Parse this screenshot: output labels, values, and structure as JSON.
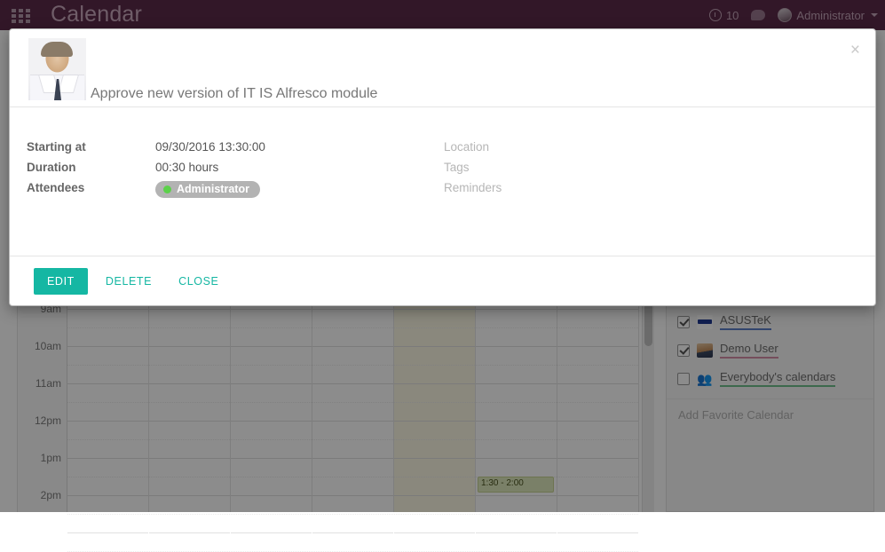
{
  "navbar": {
    "apps_icon": "apps-grid-icon",
    "brand": "Calendar",
    "activity_icon": "clock-icon",
    "activity_count": "10",
    "messages_icon": "chat-bubble-icon",
    "user_name": "Administrator",
    "user_caret": "chevron-down-icon"
  },
  "modal": {
    "title": "Approve new version of IT IS Alfresco module",
    "avatar_icon": "user-photo-avatar",
    "close_icon": "close-icon",
    "close_label": "×",
    "fields_left": [
      {
        "label": "Starting at",
        "value": "09/30/2016 13:30:00"
      },
      {
        "label": "Duration",
        "value": "00:30 hours"
      },
      {
        "label": "Attendees",
        "value": ""
      }
    ],
    "attendee": {
      "name": "Administrator",
      "status_icon": "status-dot-online",
      "status_color": "#5cd14a"
    },
    "fields_right": [
      {
        "label": "Location",
        "value": ""
      },
      {
        "label": "Tags",
        "value": ""
      },
      {
        "label": "Reminders",
        "value": ""
      }
    ],
    "footer": {
      "edit_label": "EDIT",
      "delete_label": "DELETE",
      "close_label": "CLOSE"
    }
  },
  "calendar": {
    "time_labels": [
      "9am",
      "10am",
      "11am",
      "12pm",
      "1pm",
      "2pm"
    ],
    "day_count": 7,
    "today_column_index": 4,
    "events": [
      {
        "label": "1:30 - 2:00",
        "column": 5,
        "start_hour_offset": 4.5,
        "duration_hours": 0.5
      }
    ]
  },
  "sidebar": {
    "items": [
      {
        "label": "ASUSTeK",
        "checked": true,
        "icon": "asus-logo-icon",
        "underline": "#5b7fc7"
      },
      {
        "label": "Demo User",
        "checked": true,
        "icon": "user-photo-icon",
        "underline": "#d58ea8"
      },
      {
        "label": "Everybody's calendars",
        "checked": false,
        "icon": "group-people-icon",
        "underline": "#6fbf8b"
      }
    ],
    "add_favorite_placeholder": "Add Favorite Calendar"
  },
  "colors": {
    "navbar_bg": "#5c2a4a",
    "accent_teal": "#15b7a3",
    "today_bg": "#fcf8e3",
    "event_bg": "#dfe9bd"
  }
}
